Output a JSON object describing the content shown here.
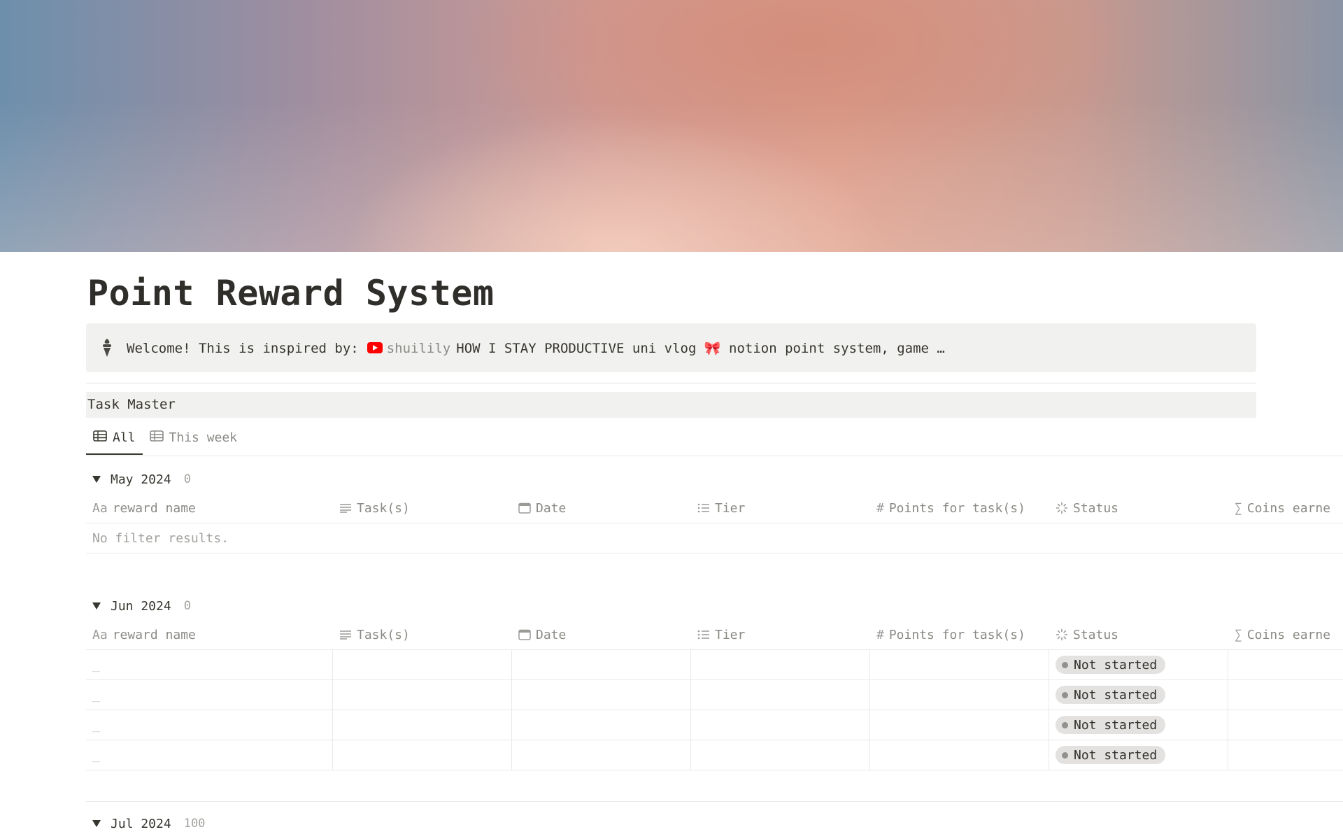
{
  "page": {
    "title": "Point Reward System"
  },
  "callout": {
    "icon": "ice-cream-icon",
    "text": "Welcome! This is inspired by:",
    "channel": "shuilily",
    "video_title": "HOW I STAY PRODUCTIVE uni vlog",
    "bow": "🎀",
    "video_rest": "notion point system, game …"
  },
  "database": {
    "title": "Task Master",
    "tabs": [
      {
        "label": "All",
        "active": true
      },
      {
        "label": "This week",
        "active": false
      }
    ],
    "columns": [
      {
        "label": "reward name",
        "icon": "Aa"
      },
      {
        "label": "Task(s)",
        "icon": "text-lines-icon"
      },
      {
        "label": "Date",
        "icon": "calendar-icon"
      },
      {
        "label": "Tier",
        "icon": "list-icon"
      },
      {
        "label": "Points for task(s)",
        "icon": "#"
      },
      {
        "label": "Status",
        "icon": "status-spinner-icon"
      },
      {
        "label": "Coins earne",
        "icon": "∑"
      }
    ],
    "groups": [
      {
        "name": "May 2024",
        "count": "0",
        "empty_text": "No filter results."
      },
      {
        "name": "Jun 2024",
        "count": "0",
        "rows": [
          {
            "placeholder": "_",
            "status": "Not started"
          },
          {
            "placeholder": "_",
            "status": "Not started"
          },
          {
            "placeholder": "_",
            "status": "Not started"
          },
          {
            "placeholder": "_",
            "status": "Not started"
          }
        ]
      },
      {
        "name": "Jul 2024",
        "count": "100"
      }
    ]
  },
  "colors": {
    "youtube_red": "#ff0000",
    "callout_bg": "#f1f1ef",
    "status_pill_bg": "#e3e2e0"
  }
}
